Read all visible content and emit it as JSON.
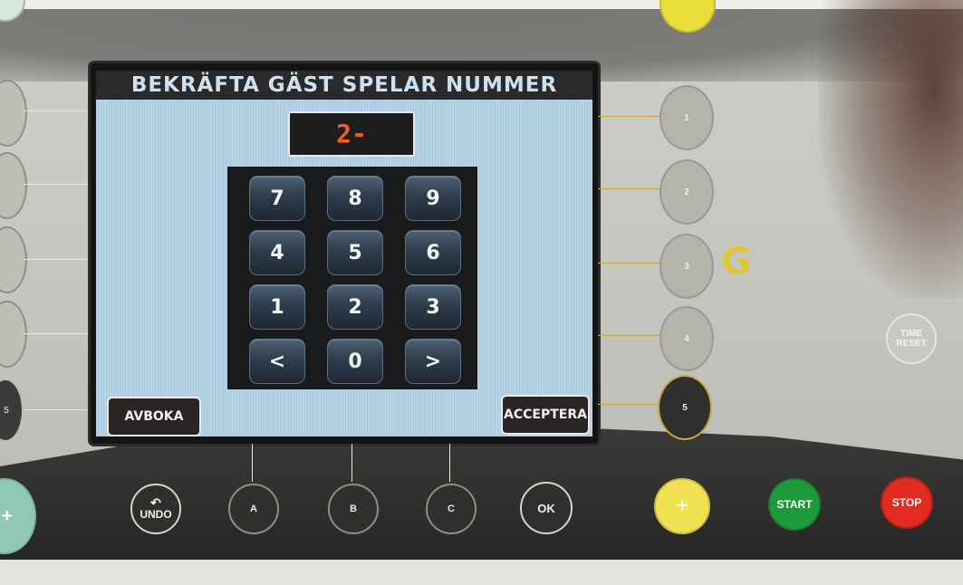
{
  "screen": {
    "title": "BEKRÄFTA GÄST SPELAR NUMMER",
    "display_value": "2-",
    "keypad": [
      "7",
      "8",
      "9",
      "4",
      "5",
      "6",
      "1",
      "2",
      "3",
      "<",
      "0",
      ">"
    ],
    "left_button": "AVBOKA",
    "right_button": "ACCEPTERA"
  },
  "side_buttons": [
    "1",
    "2",
    "3",
    "4",
    "5"
  ],
  "group_letter": "G",
  "bottom_buttons": {
    "undo": "UNDO",
    "a": "A",
    "b": "B",
    "c": "C",
    "ok": "OK",
    "plus": "+",
    "start": "START",
    "stop": "STOP"
  },
  "time_reset": [
    "TIME",
    "RESET"
  ],
  "left_plus": "+",
  "left_partial_label": "5",
  "colors": {
    "display_digits": "#ff5a1e",
    "group_letter": "#e3c531",
    "start": "#1f9a3b",
    "stop": "#e02a22",
    "plus": "#efe14f"
  }
}
